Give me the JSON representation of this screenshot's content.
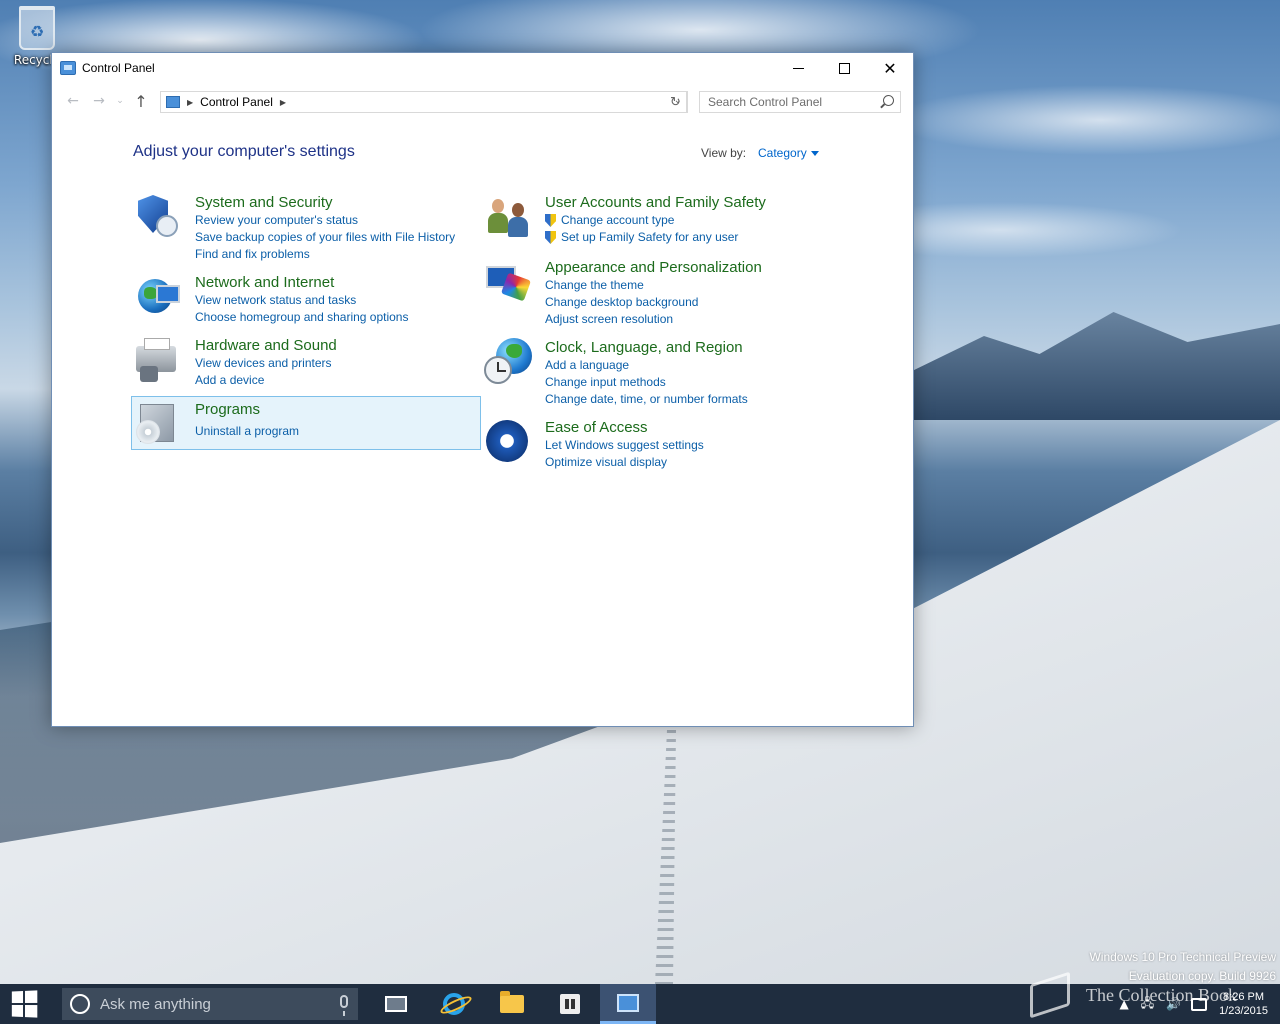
{
  "desktop": {
    "recycle_bin_label": "Recycle",
    "watermark_line1": "Windows 10 Pro Technical Preview",
    "watermark_line2": "Evaluation copy. Build 9926",
    "book_watermark": "The Collection Book"
  },
  "window": {
    "title": "Control Panel",
    "controls": {
      "minimize": "minimize",
      "maximize": "maximize",
      "close": "✕"
    }
  },
  "navbar": {
    "back_icon": "←",
    "forward_icon": "→",
    "recent_icon": "⌄",
    "up_icon": "↑",
    "breadcrumb": "Control Panel",
    "refresh_icon": "↻",
    "dropdown_icon": "⌄",
    "search_placeholder": "Search Control Panel"
  },
  "content": {
    "heading": "Adjust your computer's settings",
    "view_by_label": "View by:",
    "view_by_value": "Category",
    "categories_left": [
      {
        "title": "System and Security",
        "links": [
          "Review your computer's status",
          "Save backup copies of your files with File History",
          "Find and fix problems"
        ],
        "icon": "shield-icon"
      },
      {
        "title": "Network and Internet",
        "links": [
          "View network status and tasks",
          "Choose homegroup and sharing options"
        ],
        "icon": "network-globe-icon"
      },
      {
        "title": "Hardware and Sound",
        "links": [
          "View devices and printers",
          "Add a device"
        ],
        "icon": "printer-icon"
      },
      {
        "title": "Programs",
        "links": [
          "Uninstall a program"
        ],
        "icon": "programs-icon"
      }
    ],
    "categories_right": [
      {
        "title": "User Accounts and Family Safety",
        "links": [
          "Change account type",
          "Set up Family Safety for any user"
        ],
        "icon": "users-icon"
      },
      {
        "title": "Appearance and Personalization",
        "links": [
          "Change the theme",
          "Change desktop background",
          "Adjust screen resolution"
        ],
        "icon": "appearance-icon"
      },
      {
        "title": "Clock, Language, and Region",
        "links": [
          "Add a language",
          "Change input methods",
          "Change date, time, or number formats"
        ],
        "icon": "clock-globe-icon"
      },
      {
        "title": "Ease of Access",
        "links": [
          "Let Windows suggest settings",
          "Optimize visual display"
        ],
        "icon": "ease-of-access-icon"
      }
    ]
  },
  "taskbar": {
    "search_placeholder": "Ask me anything",
    "tray_up": "▲",
    "network": "🖧",
    "volume": "🔊",
    "time": "8:26 PM",
    "date": "1/23/2015"
  },
  "colors": {
    "accent": "#0066cc",
    "category_title": "#1c6b1c",
    "heading": "#1e3287",
    "taskbar": "#1f2d3f"
  }
}
